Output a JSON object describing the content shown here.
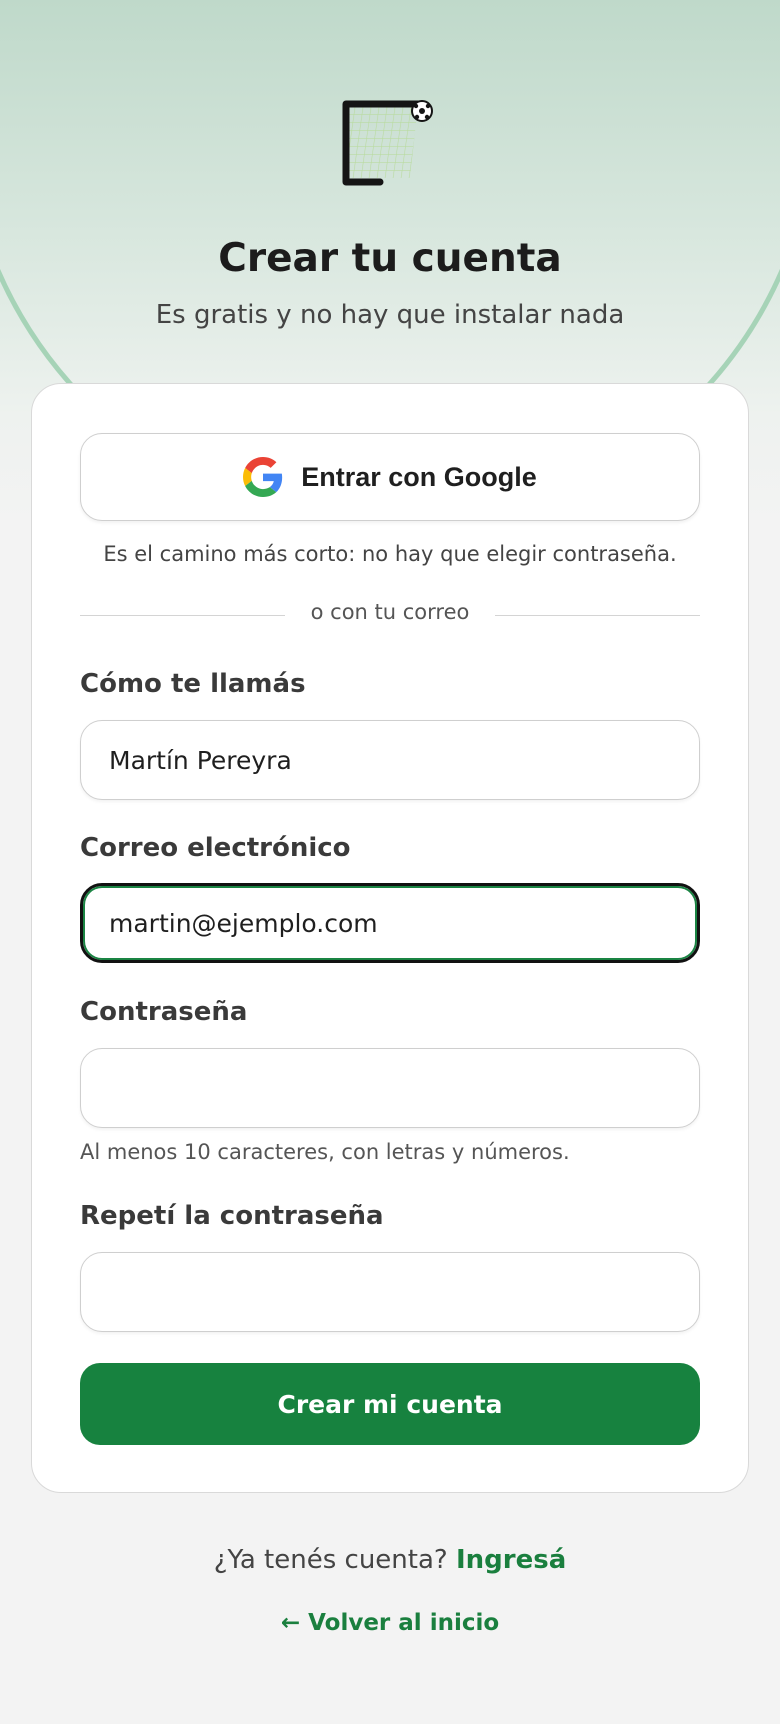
{
  "hero": {
    "title": "Crear tu cuenta",
    "subtitle": "Es gratis y no hay que instalar nada"
  },
  "google": {
    "label": "Entrar con Google",
    "hint": "Es el camino más corto: no hay que elegir contraseña."
  },
  "divider": {
    "label": "o con tu correo"
  },
  "form": {
    "name": {
      "label": "Cómo te llamás",
      "value": "Martín Pereyra"
    },
    "email": {
      "label": "Correo electrónico",
      "value": "martin@ejemplo.com"
    },
    "password": {
      "label": "Contraseña",
      "value": "",
      "help": "Al menos 10 caracteres, con letras y números."
    },
    "password_confirm": {
      "label": "Repetí la contraseña",
      "value": ""
    },
    "submit_label": "Crear mi cuenta"
  },
  "footer": {
    "login_prompt": "¿Ya tenés cuenta?",
    "login_link": "Ingresá",
    "back_link": "← Volver al inicio"
  },
  "colors": {
    "accent": "#17823f",
    "link": "#1a7f3e",
    "hero_bg": "#bfd9ca"
  }
}
